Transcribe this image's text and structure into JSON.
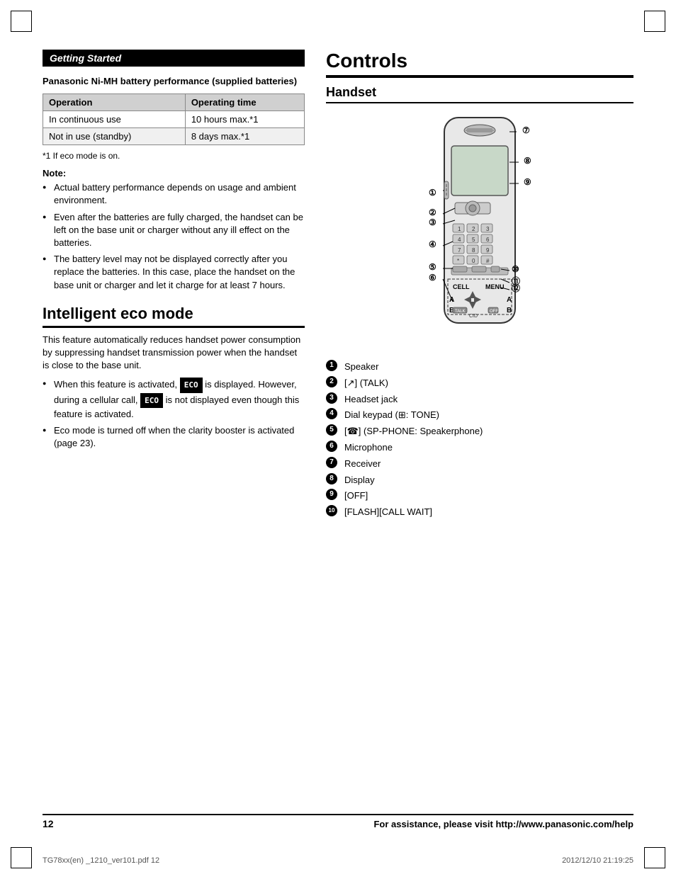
{
  "page": {
    "number": "12",
    "assistance_text": "For assistance, please visit http://www.panasonic.com/help",
    "footer_left": "TG78xx(en) _1210_ver101.pdf   12",
    "footer_right": "2012/12/10   21:19:25"
  },
  "left_column": {
    "section_header": "Getting Started",
    "battery_section": {
      "title": "Panasonic Ni-MH battery performance (supplied batteries)",
      "table": {
        "headers": [
          "Operation",
          "Operating time"
        ],
        "rows": [
          [
            "In continuous use",
            "10 hours max.*1"
          ],
          [
            "Not in use (standby)",
            "8 days max.*1"
          ]
        ]
      },
      "footnote": "*1   If eco mode is on.",
      "note_title": "Note:",
      "bullets": [
        "Actual battery performance depends on usage and ambient environment.",
        "Even after the batteries are fully charged, the handset can be left on the base unit or charger without any ill effect on the batteries.",
        "The battery level may not be displayed correctly after you replace the batteries. In this case, place the handset on the base unit or charger and let it charge for at least 7 hours."
      ]
    },
    "eco_section": {
      "title": "Intelligent eco mode",
      "description": "This feature automatically reduces handset power consumption by suppressing handset transmission power when the handset is close to the base unit.",
      "bullets": [
        "When this feature is activated, ECO is displayed. However, during a cellular call, ECO is not displayed even though this feature is activated.",
        "Eco mode is turned off when the clarity booster is activated (page 23)."
      ]
    }
  },
  "right_column": {
    "controls_title": "Controls",
    "handset_title": "Handset",
    "parts": [
      {
        "num": "1",
        "label": "Speaker"
      },
      {
        "num": "2",
        "label": "[↗] (TALK)"
      },
      {
        "num": "3",
        "label": "Headset jack"
      },
      {
        "num": "4",
        "label": "Dial keypad (¤: TONE)"
      },
      {
        "num": "5",
        "label": "[☄] (SP-PHONE: Speakerphone)"
      },
      {
        "num": "6",
        "label": "Microphone"
      },
      {
        "num": "7",
        "label": "Receiver"
      },
      {
        "num": "8",
        "label": "Display"
      },
      {
        "num": "9",
        "label": "[OFF]"
      },
      {
        "num": "10",
        "label": "[FLASH][CALL WAIT]"
      }
    ]
  }
}
